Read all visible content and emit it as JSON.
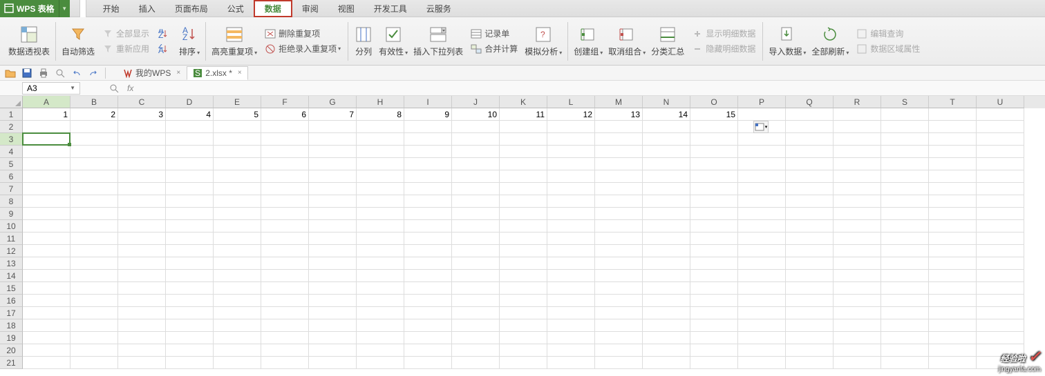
{
  "app": {
    "name": "WPS 表格"
  },
  "menu": {
    "tabs": [
      "开始",
      "插入",
      "页面布局",
      "公式",
      "数据",
      "审阅",
      "视图",
      "开发工具",
      "云服务"
    ],
    "activeIndex": 4
  },
  "ribbon": {
    "pivotTable": "数据透视表",
    "autoFilter": "自动筛选",
    "showAll": "全部显示",
    "reapply": "重新应用",
    "sort": "排序",
    "highlightDup": "高亮重复项",
    "removeDup": "删除重复项",
    "rejectDup": "拒绝录入重复项",
    "textToCol": "分列",
    "validation": "有效性",
    "insertDropdown": "插入下拉列表",
    "recordForm": "记录单",
    "consolidate": "合并计算",
    "whatIf": "模拟分析",
    "group": "创建组",
    "ungroup": "取消组合",
    "subtotal": "分类汇总",
    "showDetail": "显示明细数据",
    "hideDetail": "隐藏明细数据",
    "importData": "导入数据",
    "refreshAll": "全部刷新",
    "editQuery": "编辑查询",
    "dataRangeProps": "数据区域属性"
  },
  "docTabs": {
    "myWPS": "我的WPS",
    "file": "2.xlsx *"
  },
  "nameBox": {
    "value": "A3"
  },
  "formulaBar": {
    "fx": "fx"
  },
  "columns": [
    "A",
    "B",
    "C",
    "D",
    "E",
    "F",
    "G",
    "H",
    "I",
    "J",
    "K",
    "L",
    "M",
    "N",
    "O",
    "P",
    "Q",
    "R",
    "S",
    "T",
    "U"
  ],
  "rowCount": 21,
  "row1": [
    "1",
    "2",
    "3",
    "4",
    "5",
    "6",
    "7",
    "8",
    "9",
    "10",
    "11",
    "12",
    "13",
    "14",
    "15"
  ],
  "selectedCell": {
    "row": 3,
    "col": 0
  },
  "watermark": {
    "main": "经验啦",
    "sub": "jingyanla.com"
  }
}
